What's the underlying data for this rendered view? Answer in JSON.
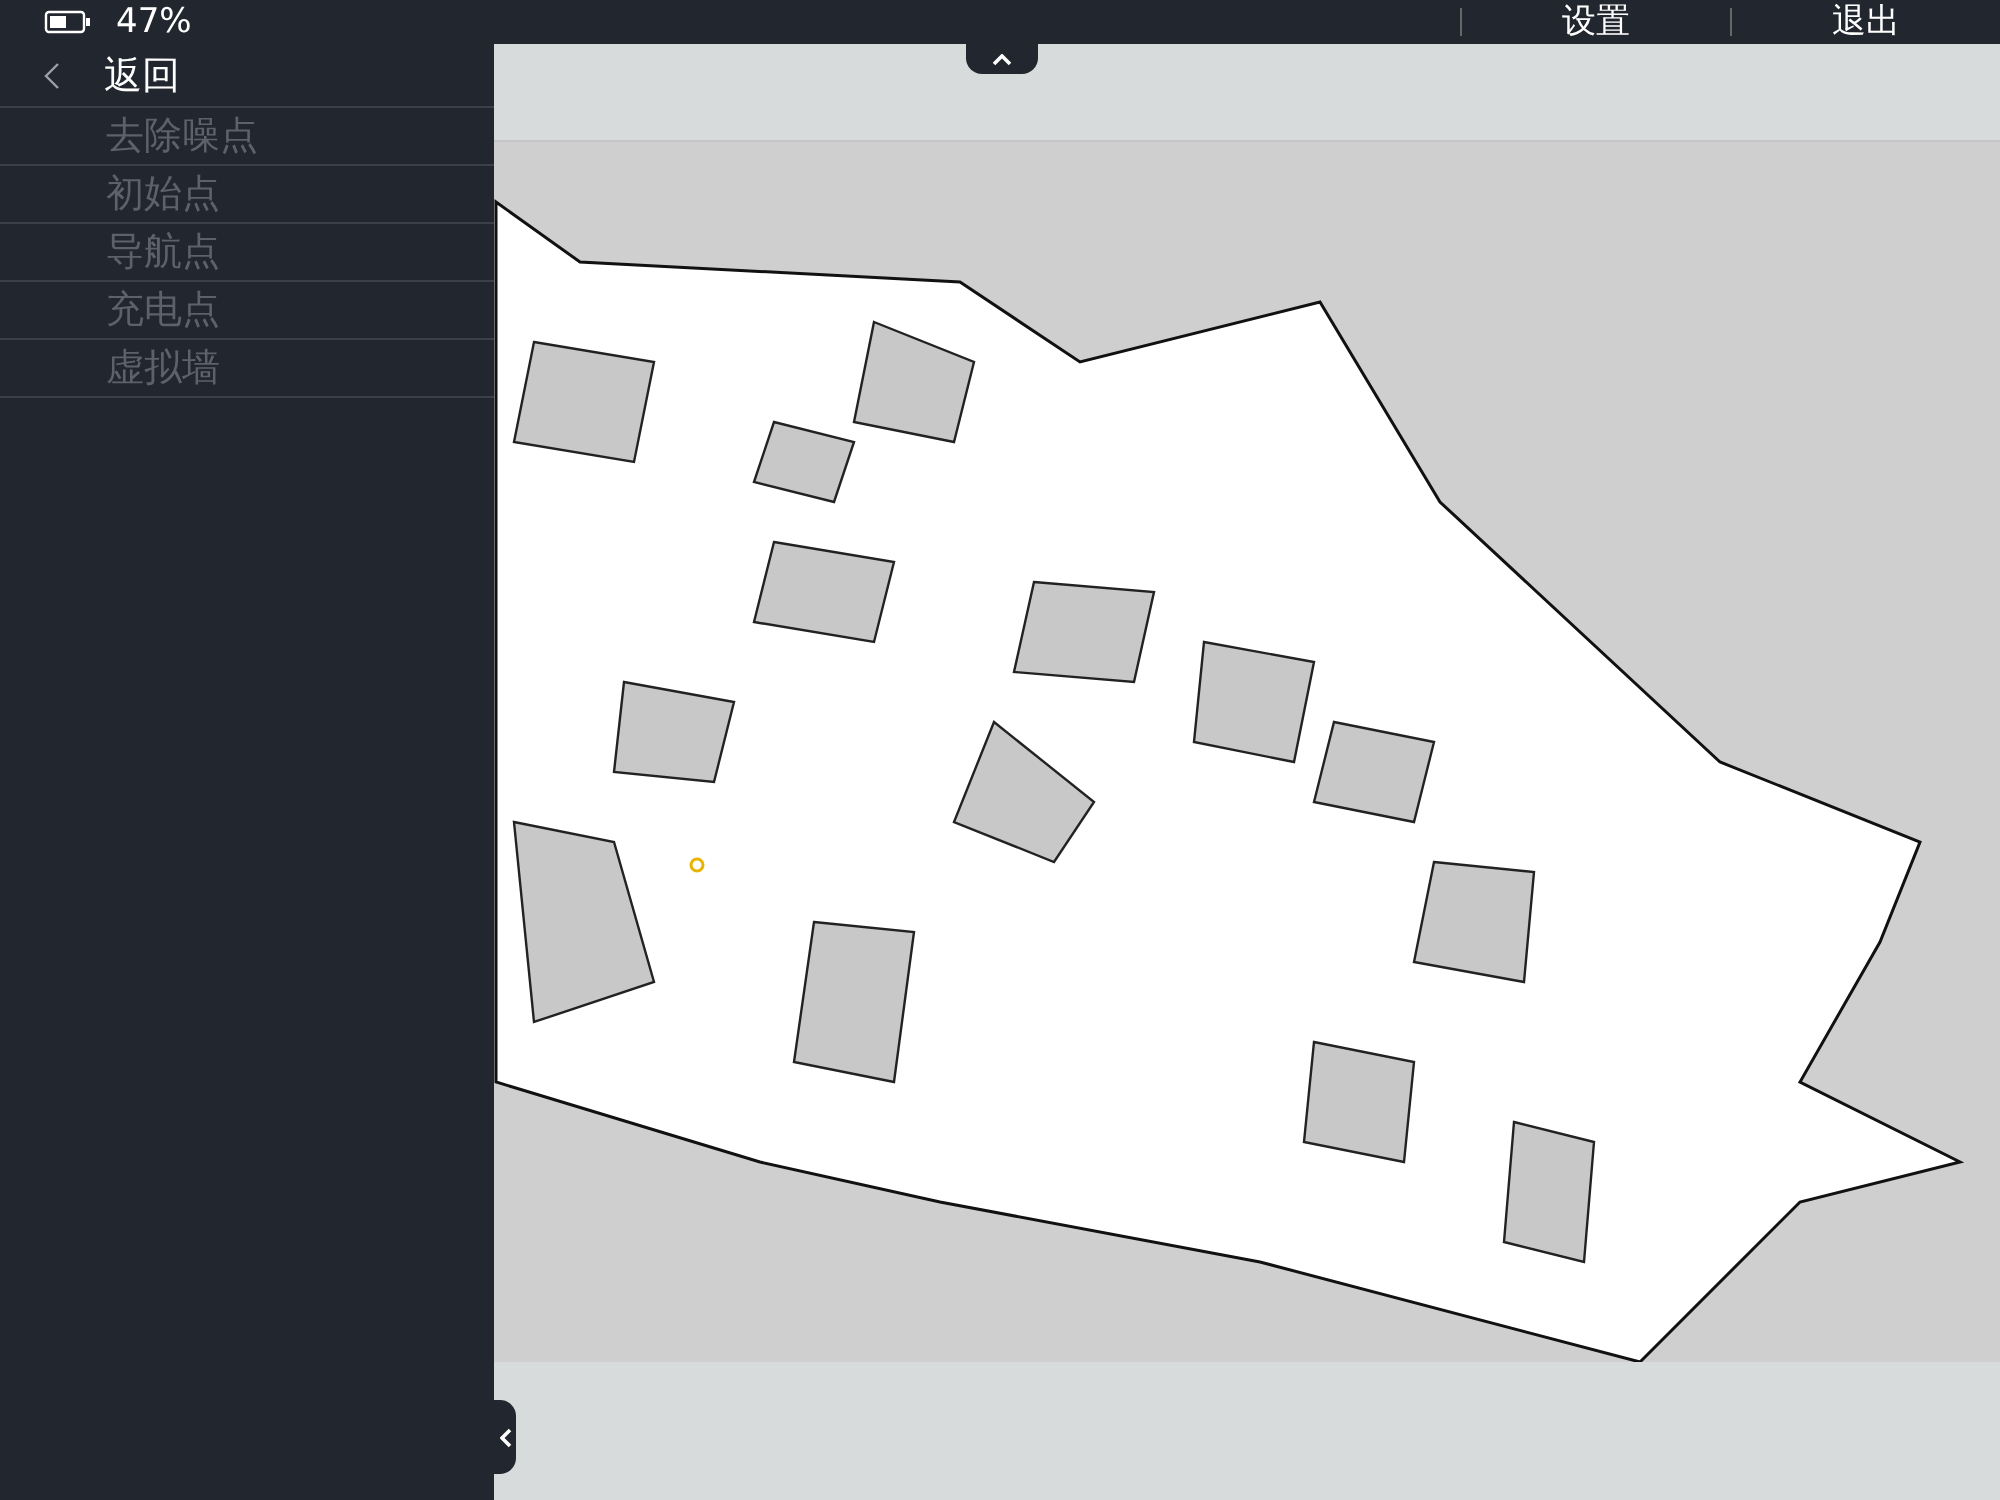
{
  "status_bar": {
    "battery": "47%"
  },
  "top_menu": [
    {
      "label": "设置"
    },
    {
      "label": "退出"
    }
  ],
  "sidebar": {
    "back": "返回",
    "items": [
      {
        "label": "去除噪点",
        "disabled": true
      },
      {
        "label": "初始点",
        "disabled": true
      },
      {
        "label": "导航点",
        "disabled": true
      },
      {
        "label": "充电点",
        "disabled": true
      },
      {
        "label": "虚拟墙",
        "disabled": true
      }
    ]
  }
}
